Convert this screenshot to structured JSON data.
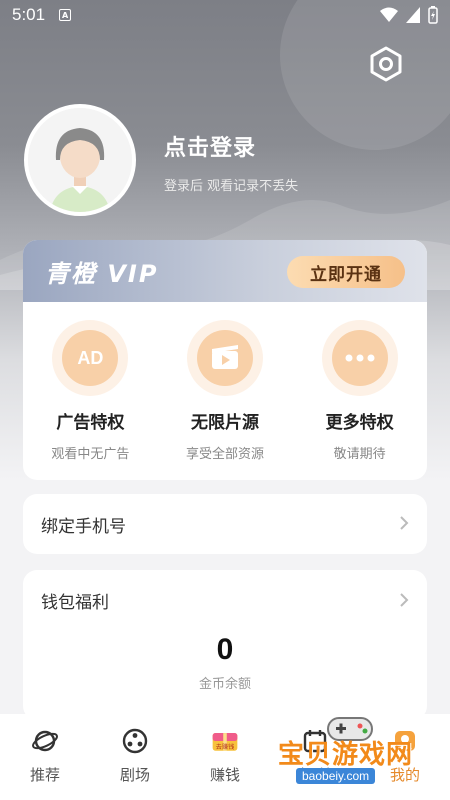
{
  "status_bar": {
    "time": "5:01",
    "a_badge": "A"
  },
  "profile": {
    "login_title": "点击登录",
    "login_subtitle": "登录后 观看记录不丢失"
  },
  "vip": {
    "title": "青橙 VIP",
    "cta_label": "立即开通",
    "features": [
      {
        "icon": "ad-icon",
        "badge": "AD",
        "name": "广告特权",
        "desc": "观看中无广告"
      },
      {
        "icon": "video-clapper-icon",
        "name": "无限片源",
        "desc": "享受全部资源"
      },
      {
        "icon": "more-dots-icon",
        "name": "更多特权",
        "desc": "敬请期待"
      }
    ]
  },
  "phone_binding": {
    "label": "绑定手机号"
  },
  "wallet": {
    "label": "钱包福利",
    "amount": "0",
    "amount_label": "金币余额"
  },
  "tabs": [
    {
      "label": "推荐",
      "icon": "planet-icon"
    },
    {
      "label": "剧场",
      "icon": "film-reel-icon"
    },
    {
      "label": "赚钱",
      "icon": "gift-icon",
      "badge": "去赚钱"
    },
    {
      "label": "福利",
      "icon": "calendar-icon"
    },
    {
      "label": "我的",
      "icon": "profile-icon"
    }
  ],
  "watermark": {
    "text": "宝贝游戏网",
    "url": "baobeiy.com"
  },
  "colors": {
    "accent": "#e58a2b",
    "vip_gradient_start": "#9aa6c0",
    "vip_button": "#f6c089"
  }
}
